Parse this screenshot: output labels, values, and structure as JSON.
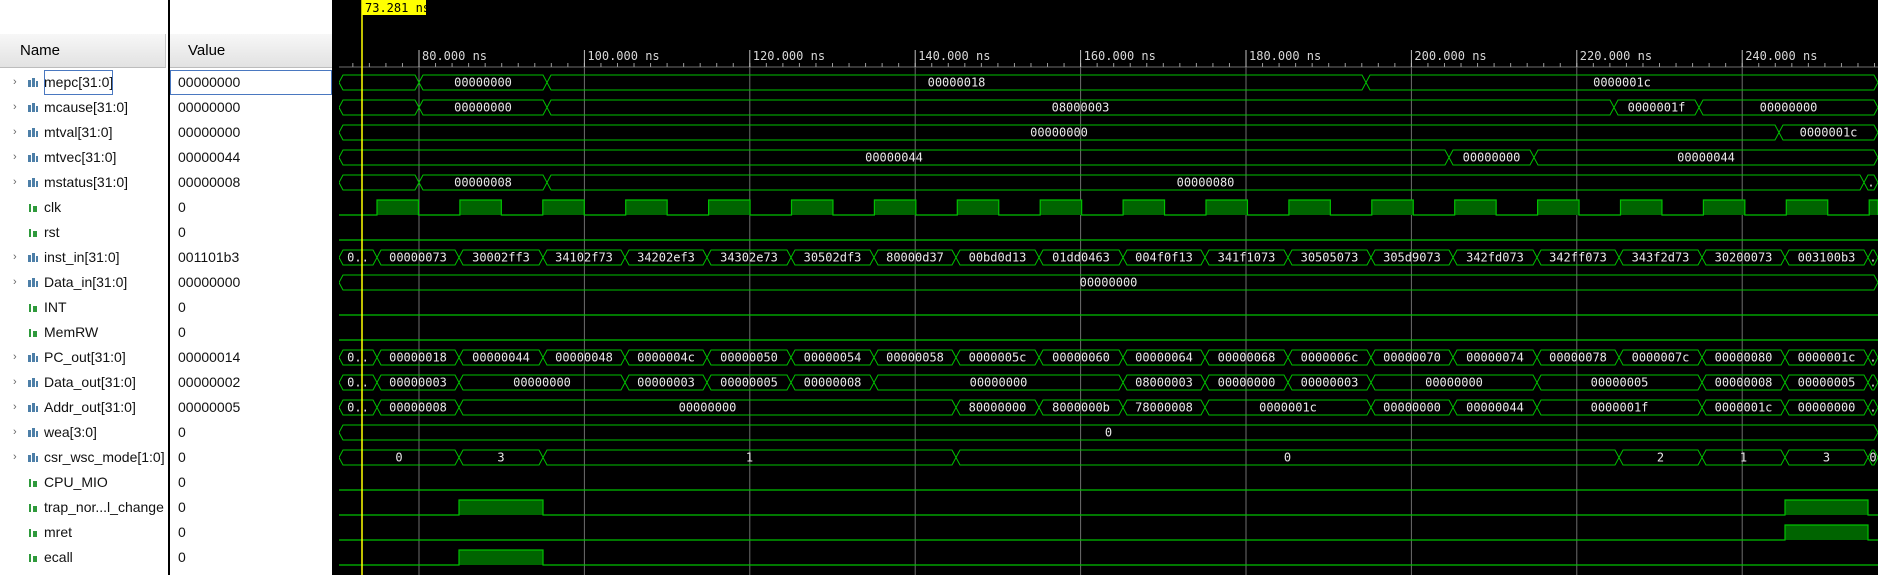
{
  "header": {
    "name_label": "Name",
    "value_label": "Value"
  },
  "cursor": {
    "time": "73.281 ns"
  },
  "timeline": {
    "tick_labels": [
      "80.000 ns",
      "100.000 ns",
      "120.000 ns",
      "140.000 ns",
      "160.000 ns",
      "180.000 ns",
      "200.000 ns",
      "220.000 ns",
      "240.000 ns"
    ]
  },
  "colors": {
    "wave": "#00c000",
    "cursor": "#ffff00",
    "grid": "#6e6e6e"
  },
  "signals": [
    {
      "name": "mepc[31:0]",
      "value": "00000000",
      "icon": "bus-icon",
      "bus": true,
      "segs": [
        [
          0,
          80,
          ""
        ],
        [
          80,
          208,
          "00000000"
        ],
        [
          208,
          1027,
          "00000018"
        ],
        [
          1027,
          1539,
          "0000001c"
        ]
      ]
    },
    {
      "name": "mcause[31:0]",
      "value": "00000000",
      "icon": "bus-icon",
      "bus": true,
      "segs": [
        [
          0,
          80,
          ""
        ],
        [
          80,
          208,
          "00000000"
        ],
        [
          208,
          1275,
          "08000003"
        ],
        [
          1275,
          1360,
          "0000001f"
        ],
        [
          1360,
          1539,
          "00000000"
        ]
      ]
    },
    {
      "name": "mtval[31:0]",
      "value": "00000000",
      "icon": "bus-icon",
      "bus": true,
      "segs": [
        [
          0,
          1440,
          "00000000"
        ],
        [
          1440,
          1539,
          "0000001c"
        ]
      ]
    },
    {
      "name": "mtvec[31:0]",
      "value": "00000044",
      "icon": "bus-icon",
      "bus": true,
      "segs": [
        [
          0,
          1110,
          "00000044"
        ],
        [
          1110,
          1195,
          "00000000"
        ],
        [
          1195,
          1539,
          "00000044"
        ]
      ]
    },
    {
      "name": "mstatus[31:0]",
      "value": "00000008",
      "icon": "bus-icon",
      "bus": true,
      "segs": [
        [
          0,
          80,
          ""
        ],
        [
          80,
          208,
          "00000008"
        ],
        [
          208,
          1525,
          "00000080"
        ],
        [
          1525,
          1539,
          "."
        ]
      ]
    },
    {
      "name": "clk",
      "value": "0",
      "icon": "bit-icon",
      "bus": false,
      "type": "clock"
    },
    {
      "name": "rst",
      "value": "0",
      "icon": "bit-icon",
      "bus": false,
      "type": "low"
    },
    {
      "name": "inst_in[31:0]",
      "value": "001101b3",
      "icon": "bus-icon",
      "bus": true,
      "segs": [
        [
          0,
          38,
          "0.."
        ],
        [
          38,
          120,
          "00000073"
        ],
        [
          120,
          204,
          "30002ff3"
        ],
        [
          204,
          286,
          "34102f73"
        ],
        [
          286,
          368,
          "34202ef3"
        ],
        [
          368,
          452,
          "34302e73"
        ],
        [
          452,
          535,
          "30502df3"
        ],
        [
          535,
          617,
          "80000d37"
        ],
        [
          617,
          700,
          "00bd0d13"
        ],
        [
          700,
          784,
          "01dd0463"
        ],
        [
          784,
          866,
          "004f0f13"
        ],
        [
          866,
          949,
          "341f1073"
        ],
        [
          949,
          1032,
          "30505073"
        ],
        [
          1032,
          1114,
          "305d9073"
        ],
        [
          1114,
          1198,
          "342fd073"
        ],
        [
          1198,
          1280,
          "342ff073"
        ],
        [
          1280,
          1363,
          "343f2d73"
        ],
        [
          1363,
          1446,
          "30200073"
        ],
        [
          1446,
          1529,
          "003100b3"
        ],
        [
          1529,
          1539,
          "."
        ]
      ]
    },
    {
      "name": "Data_in[31:0]",
      "value": "00000000",
      "icon": "bus-icon",
      "bus": true,
      "segs": [
        [
          0,
          1539,
          "00000000"
        ]
      ]
    },
    {
      "name": "INT",
      "value": "0",
      "icon": "bit-icon",
      "bus": false,
      "type": "low"
    },
    {
      "name": "MemRW",
      "value": "0",
      "icon": "bit-icon",
      "bus": false,
      "type": "low"
    },
    {
      "name": "PC_out[31:0]",
      "value": "00000014",
      "icon": "bus-icon",
      "bus": true,
      "segs": [
        [
          0,
          38,
          "0.."
        ],
        [
          38,
          120,
          "00000018"
        ],
        [
          120,
          204,
          "00000044"
        ],
        [
          204,
          286,
          "00000048"
        ],
        [
          286,
          368,
          "0000004c"
        ],
        [
          368,
          452,
          "00000050"
        ],
        [
          452,
          535,
          "00000054"
        ],
        [
          535,
          617,
          "00000058"
        ],
        [
          617,
          700,
          "0000005c"
        ],
        [
          700,
          784,
          "00000060"
        ],
        [
          784,
          866,
          "00000064"
        ],
        [
          866,
          949,
          "00000068"
        ],
        [
          949,
          1032,
          "0000006c"
        ],
        [
          1032,
          1114,
          "00000070"
        ],
        [
          1114,
          1198,
          "00000074"
        ],
        [
          1198,
          1280,
          "00000078"
        ],
        [
          1280,
          1363,
          "0000007c"
        ],
        [
          1363,
          1446,
          "00000080"
        ],
        [
          1446,
          1529,
          "0000001c"
        ],
        [
          1529,
          1539,
          "."
        ]
      ]
    },
    {
      "name": "Data_out[31:0]",
      "value": "00000002",
      "icon": "bus-icon",
      "bus": true,
      "segs": [
        [
          0,
          38,
          "0.."
        ],
        [
          38,
          120,
          "00000003"
        ],
        [
          120,
          286,
          "00000000"
        ],
        [
          286,
          368,
          "00000003"
        ],
        [
          368,
          452,
          "00000005"
        ],
        [
          452,
          535,
          "00000008"
        ],
        [
          535,
          784,
          "00000000"
        ],
        [
          784,
          866,
          "08000003"
        ],
        [
          866,
          949,
          "00000000"
        ],
        [
          949,
          1032,
          "00000003"
        ],
        [
          1032,
          1198,
          "00000000"
        ],
        [
          1198,
          1363,
          "00000005"
        ],
        [
          1363,
          1446,
          "00000008"
        ],
        [
          1446,
          1529,
          "00000005"
        ],
        [
          1529,
          1539,
          "."
        ]
      ]
    },
    {
      "name": "Addr_out[31:0]",
      "value": "00000005",
      "icon": "bus-icon",
      "bus": true,
      "segs": [
        [
          0,
          38,
          "0.."
        ],
        [
          38,
          120,
          "00000008"
        ],
        [
          120,
          617,
          "00000000"
        ],
        [
          617,
          700,
          "80000000"
        ],
        [
          700,
          784,
          "8000000b"
        ],
        [
          784,
          866,
          "78000008"
        ],
        [
          866,
          1032,
          "0000001c"
        ],
        [
          1032,
          1114,
          "00000000"
        ],
        [
          1114,
          1198,
          "00000044"
        ],
        [
          1198,
          1363,
          "0000001f"
        ],
        [
          1363,
          1446,
          "0000001c"
        ],
        [
          1446,
          1529,
          "00000000"
        ],
        [
          1529,
          1539,
          "."
        ]
      ]
    },
    {
      "name": "wea[3:0]",
      "value": "0",
      "icon": "bus-icon",
      "bus": true,
      "segs": [
        [
          0,
          1539,
          "0"
        ]
      ]
    },
    {
      "name": "csr_wsc_mode[1:0]",
      "value": "0",
      "icon": "bus-icon",
      "bus": true,
      "segs": [
        [
          0,
          120,
          "0"
        ],
        [
          120,
          204,
          "3"
        ],
        [
          204,
          617,
          "1"
        ],
        [
          617,
          1280,
          "0"
        ],
        [
          1280,
          1363,
          "2"
        ],
        [
          1363,
          1446,
          "1"
        ],
        [
          1446,
          1529,
          "3"
        ],
        [
          1529,
          1539,
          "0"
        ]
      ]
    },
    {
      "name": "CPU_MIO",
      "value": "0",
      "icon": "bit-icon",
      "bus": false,
      "type": "low"
    },
    {
      "name": "trap_nor...l_change",
      "value": "0",
      "icon": "bit-icon",
      "bus": false,
      "type": "pulse",
      "pulses": [
        [
          120,
          204
        ],
        [
          1446,
          1529
        ]
      ]
    },
    {
      "name": "mret",
      "value": "0",
      "icon": "bit-icon",
      "bus": false,
      "type": "pulse",
      "pulses": [
        [
          1446,
          1529
        ]
      ]
    },
    {
      "name": "ecall",
      "value": "0",
      "icon": "bit-icon",
      "bus": false,
      "type": "pulse",
      "pulses": [
        [
          120,
          204
        ]
      ]
    }
  ]
}
